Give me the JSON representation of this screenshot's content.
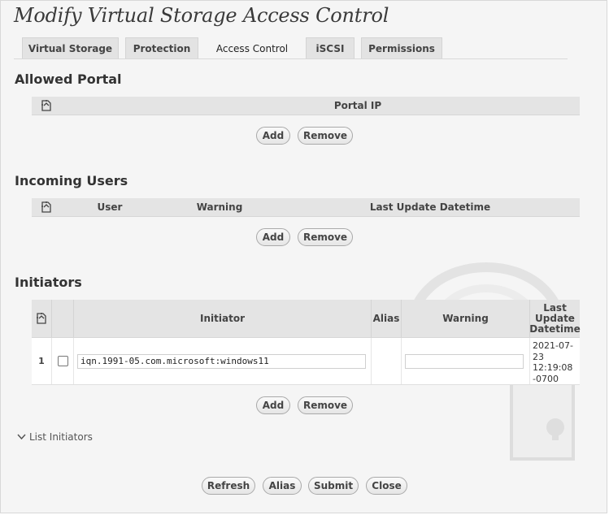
{
  "page": {
    "title": "Modify Virtual Storage Access Control"
  },
  "tabs": [
    {
      "label": "Virtual Storage"
    },
    {
      "label": "Protection"
    },
    {
      "label": "Access Control",
      "active": true
    },
    {
      "label": "iSCSI"
    },
    {
      "label": "Permissions"
    }
  ],
  "allowed_portal": {
    "title": "Allowed Portal",
    "columns": [
      "Portal IP"
    ],
    "rows": [],
    "add_label": "Add",
    "remove_label": "Remove"
  },
  "incoming_users": {
    "title": "Incoming Users",
    "columns": [
      "User",
      "Warning",
      "Last Update Datetime"
    ],
    "rows": [],
    "add_label": "Add",
    "remove_label": "Remove"
  },
  "initiators": {
    "title": "Initiators",
    "columns": [
      "Initiator",
      "Alias",
      "Warning",
      "Last Update Datetime"
    ],
    "rows": [
      {
        "index": "1",
        "checked": false,
        "initiator": "iqn.1991-05.com.microsoft:windows11",
        "alias": "",
        "warning": "",
        "last_update": "2021-07-23 12:19:08 -0700"
      }
    ],
    "add_label": "Add",
    "remove_label": "Remove"
  },
  "list_initiators": {
    "label": "List Initiators",
    "icon": "chevron-down-icon"
  },
  "footer": {
    "refresh_label": "Refresh",
    "alias_label": "Alias",
    "submit_label": "Submit",
    "close_label": "Close"
  },
  "icons": {
    "column_chooser": "column-chooser-icon",
    "watermark": "padlock-icon"
  },
  "colors": {
    "background": "#f5f5f5",
    "header": "#e4e4e4",
    "watermark": "#e2e2e2"
  }
}
